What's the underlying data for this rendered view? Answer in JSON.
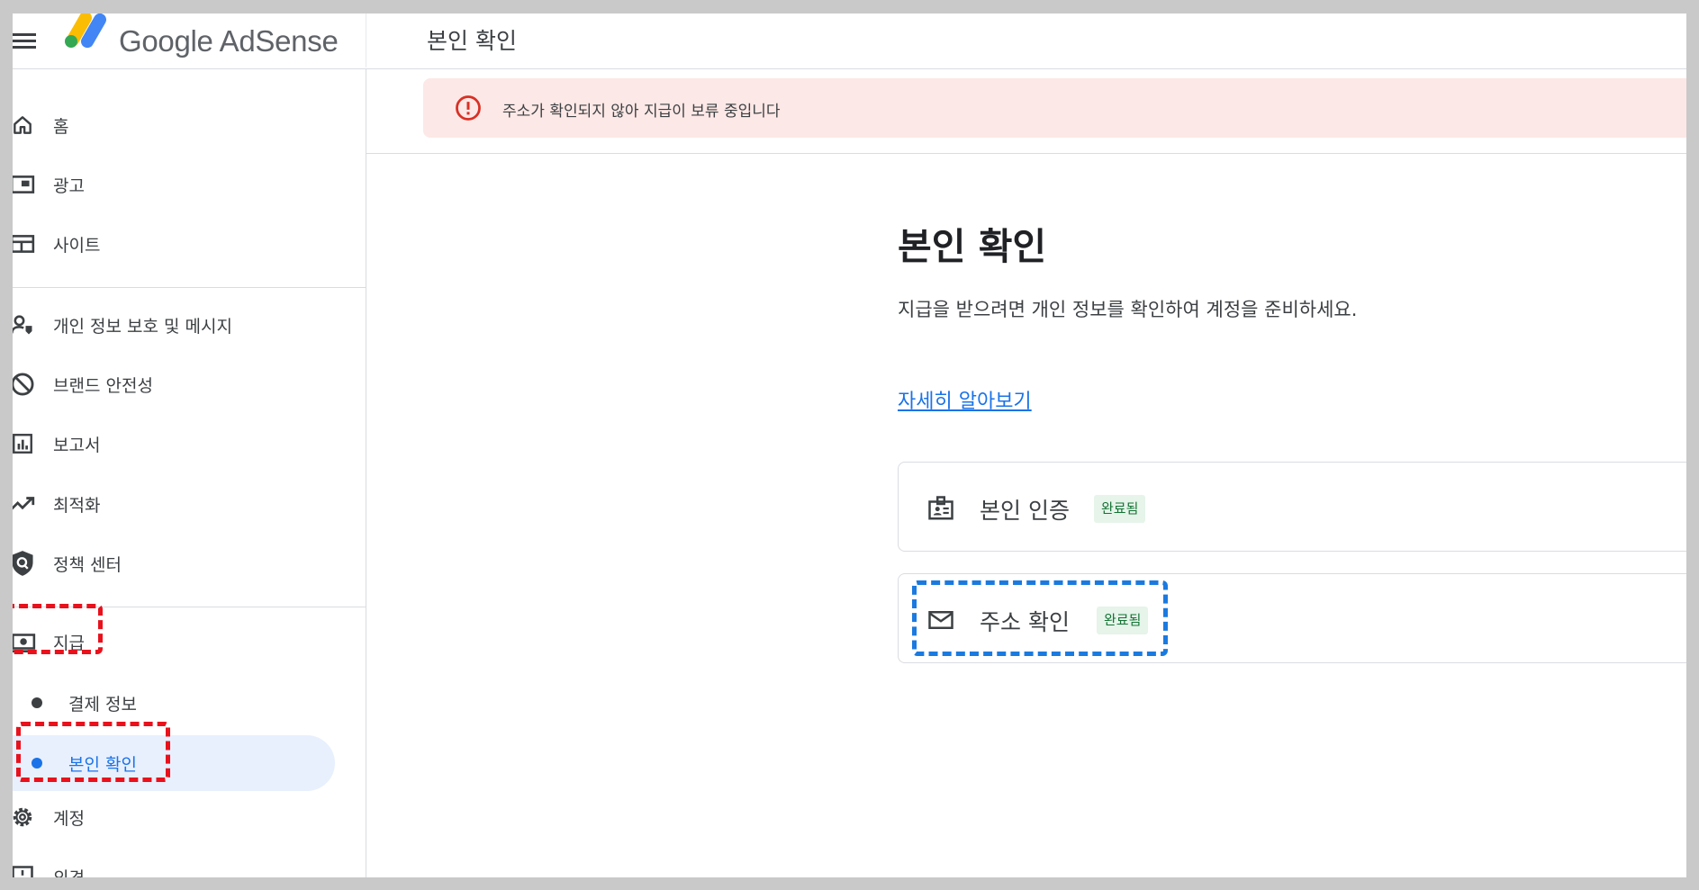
{
  "header": {
    "brand": "Google AdSense",
    "page_title": "본인 확인"
  },
  "sidebar": {
    "items": [
      {
        "label": "홈",
        "icon": "home-icon"
      },
      {
        "label": "광고",
        "icon": "ads-icon"
      },
      {
        "label": "사이트",
        "icon": "sites-icon"
      },
      {
        "label": "개인 정보 보호 및 메시지",
        "icon": "privacy-messaging-icon"
      },
      {
        "label": "브랜드 안전성",
        "icon": "block-icon"
      },
      {
        "label": "보고서",
        "icon": "bar-chart-icon"
      },
      {
        "label": "최적화",
        "icon": "trending-up-icon"
      },
      {
        "label": "정책 센터",
        "icon": "policy-shield-icon"
      },
      {
        "label": "지급",
        "icon": "payments-icon"
      }
    ],
    "payments_sub": [
      {
        "label": "결제 정보"
      },
      {
        "label": "본인 확인"
      }
    ],
    "bottom_items": [
      {
        "label": "계정",
        "icon": "gear-icon"
      },
      {
        "label": "의견",
        "icon": "feedback-icon"
      }
    ]
  },
  "alert": {
    "text": "주소가 확인되지 않아 지급이 보류 중입니다",
    "icon": "error-icon",
    "color": "#fce8e6"
  },
  "main": {
    "title": "본인 확인",
    "description": "지급을 받으려면 개인 정보를 확인하여 계정을 준비하세요.",
    "learn_more": "자세히 알아보기",
    "cards": [
      {
        "label": "본인 인증",
        "status": "완료됨",
        "icon": "id-badge-icon"
      },
      {
        "label": "주소 확인",
        "status": "완료됨",
        "icon": "mail-icon"
      }
    ]
  },
  "colors": {
    "accent": "#1a73e8",
    "annotation_red": "#e8111c",
    "annotation_blue": "#1a7ae0",
    "badge_bg": "#e6f4ea",
    "badge_text": "#137333"
  }
}
